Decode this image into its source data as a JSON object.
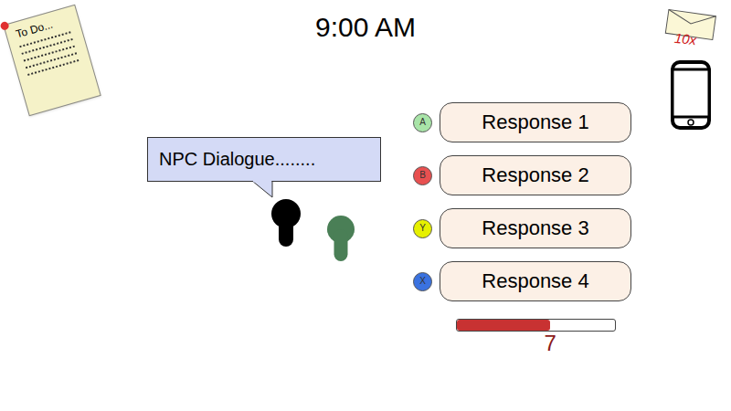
{
  "todo": {
    "title": "To Do..."
  },
  "clock": "9:00 AM",
  "mail": {
    "count": "10x"
  },
  "npc": {
    "dialogue": "NPC Dialogue........"
  },
  "characters": [
    {
      "name": "npc",
      "color": "#000000"
    },
    {
      "name": "player",
      "color": "#4a7f56"
    }
  ],
  "responses": [
    {
      "button": "A",
      "label": "Response 1",
      "color": "#a8e4a8"
    },
    {
      "button": "B",
      "label": "Response 2",
      "color": "#e85050"
    },
    {
      "button": "Y",
      "label": "Response 3",
      "color": "#e6f000"
    },
    {
      "button": "X",
      "label": "Response 4",
      "color": "#3a72e0"
    }
  ],
  "meter": {
    "level": 0.59,
    "value": "7"
  }
}
